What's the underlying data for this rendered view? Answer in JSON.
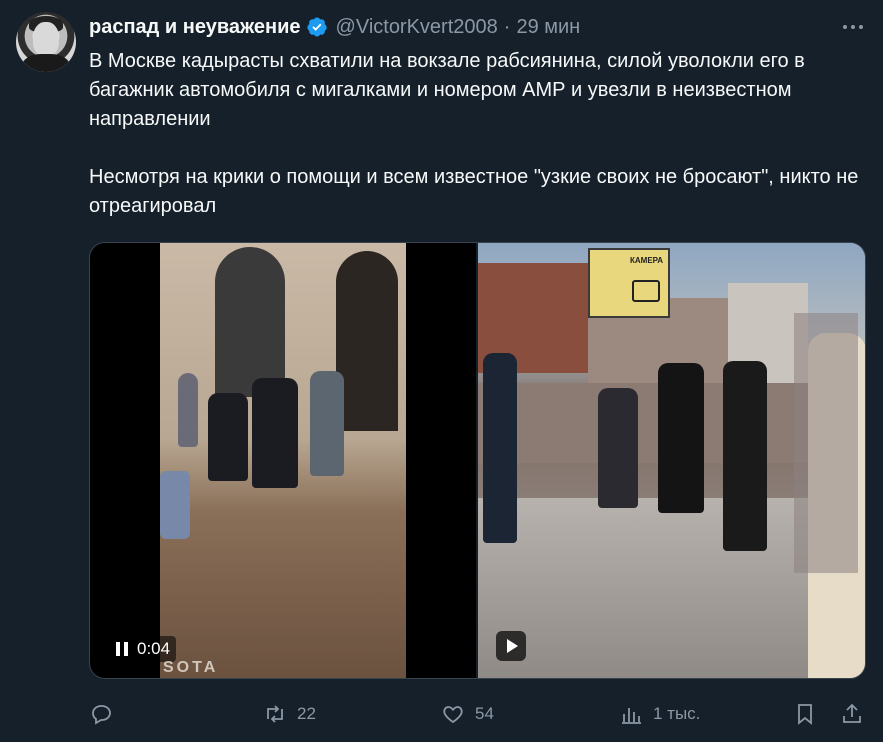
{
  "author": {
    "display_name": "распад и неуважение",
    "handle": "@VictorKvert2008",
    "separator": "·",
    "time": "29 мин"
  },
  "tweet": {
    "paragraphs": [
      "В Москве кадырасты схватили на вокзале рабсиянина, силой уволокли его в багажник автомобиля с мигалками и номером АМР и увезли в неизвестном направлении",
      "Несмотря на крики о помощи и всем известное \"узкие своих не бросают\", никто не отреагировал"
    ]
  },
  "media": {
    "left_video": {
      "timestamp": "0:04",
      "watermark": "SOTA"
    },
    "right_video": {
      "sign_text": "КАМЕРА"
    }
  },
  "actions": {
    "reply_count": "",
    "retweet_count": "22",
    "like_count": "54",
    "views_count": "1 тыс."
  },
  "colors": {
    "background": "#15202b",
    "text": "#f7f9f9",
    "muted": "#8b98a5",
    "verified": "#1d9bf0"
  }
}
